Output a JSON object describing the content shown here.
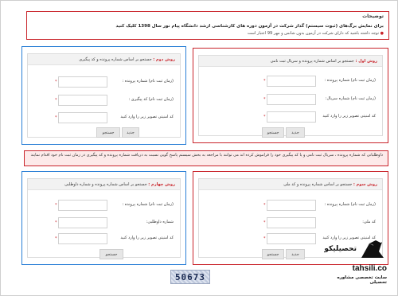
{
  "notice": {
    "title": "توضیحات",
    "line1": "برای نمایش برگ‌های (ثبوت سیستم) گذار شرکت در آزمون دوره های کارشناسی ارشد دانشگاه پیام نور سال 1398 کلیک کنید",
    "line2": "توجه داشته باشید که دارای شرکت در آزمون بدون شانس و مهر 99 اعتبار است"
  },
  "panels": {
    "p1": {
      "method": "روش اول :",
      "desc": "جستجو بر اساس شماره پرونده و سریال ثبت نامی",
      "f1": "(زمان ثبت نام) شماره پرونده :",
      "f2": "(زمان ثبت نام) شماره سریال:",
      "f3": "کد امنیتی تصویر زیر را وارد کنید",
      "new": "جدید",
      "search": "جستجو"
    },
    "p2": {
      "method": "روش دوم :",
      "desc": "جستجو بر اساس شماره پرونده و کد پیگیری",
      "f1": "(زمان ثبت نام) شماره پرونده :",
      "f2": "(زمان ثبت نام) کد پیگیری :",
      "f3": "کد امنیتی تصویر زیر را وارد کنید",
      "new": "جدید",
      "search": "جستجو"
    },
    "p3": {
      "method": "روش سوم :",
      "desc": "جستجو بر اساس شماره پرونده و کد ملی",
      "f1": "(زمان ثبت نام) شماره پرونده :",
      "f2": "کد ملی:",
      "f3": "کد امنیتی تصویر زیر را وارد کنید",
      "new": "جدید",
      "search": "جستجو"
    },
    "p4": {
      "method": "روش چهارم :",
      "desc": "جستجو بر اساس شماره پرونده و شماره داوطلبی",
      "f1": "(زمان ثبت نام) شماره پرونده :",
      "f2": "شماره داوطلبی:",
      "f3": "کد امنیتی تصویر زیر را وارد کنید",
      "search": "جستجو"
    }
  },
  "warning": "داوطلبانی که شماره پرونده ، سریال ثبت نامی و یا کد پیگیری خود را فراموش کرده اند می توانند با مراجعه به بخش سیستم پاسخ گویی نسبت به دریافت شماره پرونده و کد پیگیری در زمان ثبت نام خود اقدام نمایند",
  "captcha": "50673",
  "brand": {
    "name": "تحصیلیکو",
    "site": "tahsili.co",
    "subtitle": "سایت تخصصی مشاوره تحصیلی"
  },
  "colors": {
    "red": "#c9242b",
    "blue": "#2a7fd6"
  }
}
